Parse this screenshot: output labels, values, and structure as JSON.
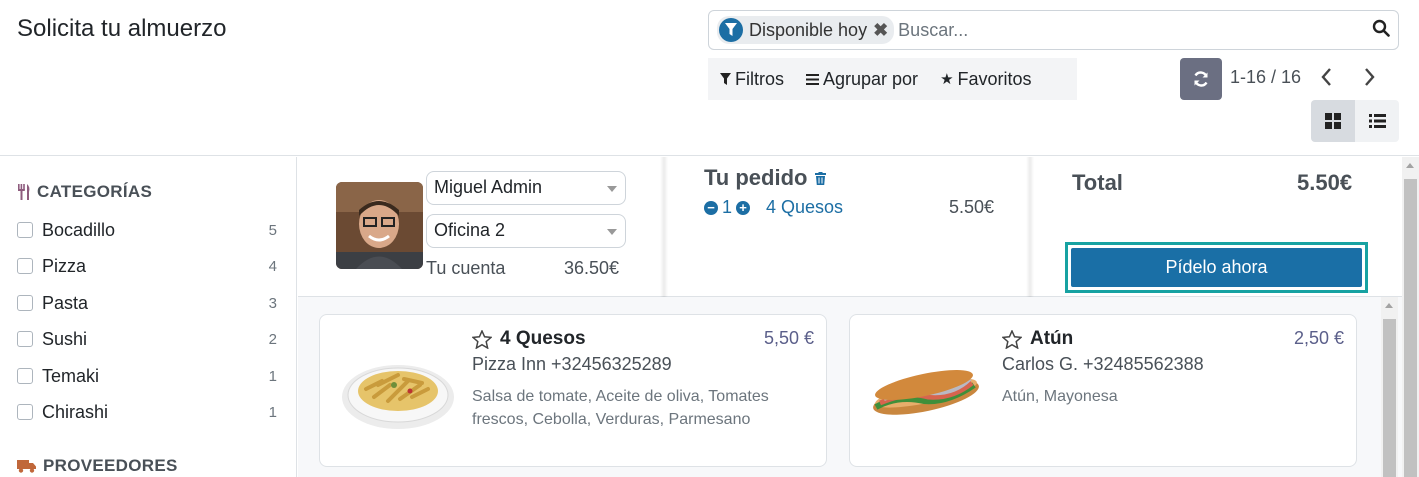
{
  "header": {
    "title": "Solicita tu almuerzo",
    "search": {
      "facet_label": "Disponible hoy",
      "placeholder": "Buscar..."
    },
    "filters": {
      "filtros": "Filtros",
      "agrupar": "Agrupar por",
      "favoritos": "Favoritos"
    },
    "pager": "1-16 / 16"
  },
  "sidebar": {
    "categories_title": "CATEGORÍAS",
    "categories": [
      {
        "label": "Bocadillo",
        "count": "5"
      },
      {
        "label": "Pizza",
        "count": "4"
      },
      {
        "label": "Pasta",
        "count": "3"
      },
      {
        "label": "Sushi",
        "count": "2"
      },
      {
        "label": "Temaki",
        "count": "1"
      },
      {
        "label": "Chirashi",
        "count": "1"
      }
    ],
    "suppliers_title": "PROVEEDORES"
  },
  "order": {
    "user": "Miguel Admin",
    "location": "Oficina 2",
    "account_label": "Tu cuenta",
    "account_value": "36.50€",
    "title": "Tu pedido",
    "line": {
      "qty": "1",
      "name": "4 Quesos",
      "price": "5.50€"
    },
    "total_label": "Total",
    "total_value": "5.50€",
    "order_button": "Pídelo ahora"
  },
  "products": [
    {
      "name": "4 Quesos",
      "price": "5,50 €",
      "vendor": "Pizza Inn +32456325289",
      "description": "Salsa de tomate, Aceite de oliva, Tomates frescos, Cebolla, Verduras, Parmesano"
    },
    {
      "name": "Atún",
      "price": "2,50 €",
      "vendor": "Carlos G. +32485562388",
      "description": "Atún, Mayonesa"
    }
  ],
  "colors": {
    "primary": "#1a6fa6",
    "accent_teal": "#17a2a2",
    "refresh_btn": "#6b6f82"
  }
}
